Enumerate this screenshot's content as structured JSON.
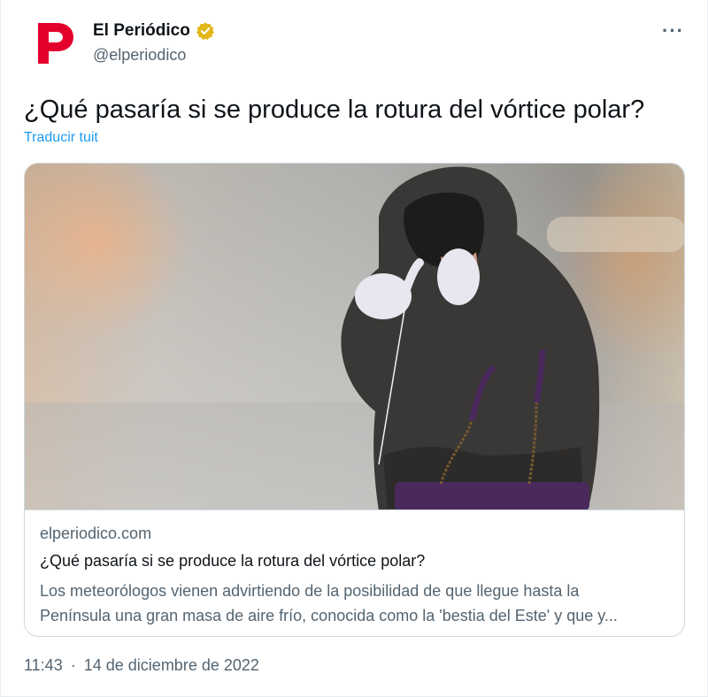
{
  "author": {
    "name": "El Periódico",
    "handle": "@elperiodico",
    "verified": true,
    "avatar_icon": "el-periodico-logo-icon",
    "brand_color": "#e3002b"
  },
  "tweet": {
    "text": "¿Qué pasaría si se produce la rotura del vórtice polar?",
    "translate_label": "Traducir tuit",
    "more_label": "···"
  },
  "card": {
    "domain": "elperiodico.com",
    "title": "¿Qué pasaría si se produce la rotura del vórtice polar?",
    "description_line1": "Los meteorólogos vienen advirtiendo de la posibilidad de que llegue hasta la",
    "description_line2": "Península una gran masa de aire frío, conocida como la 'bestia del Este' y que y..."
  },
  "meta": {
    "time": "11:43",
    "separator": "·",
    "date": "14 de diciembre de 2022"
  },
  "colors": {
    "link_blue": "#1d9bf0",
    "secondary_text": "#536471",
    "verified_gold": "#e2b719"
  }
}
